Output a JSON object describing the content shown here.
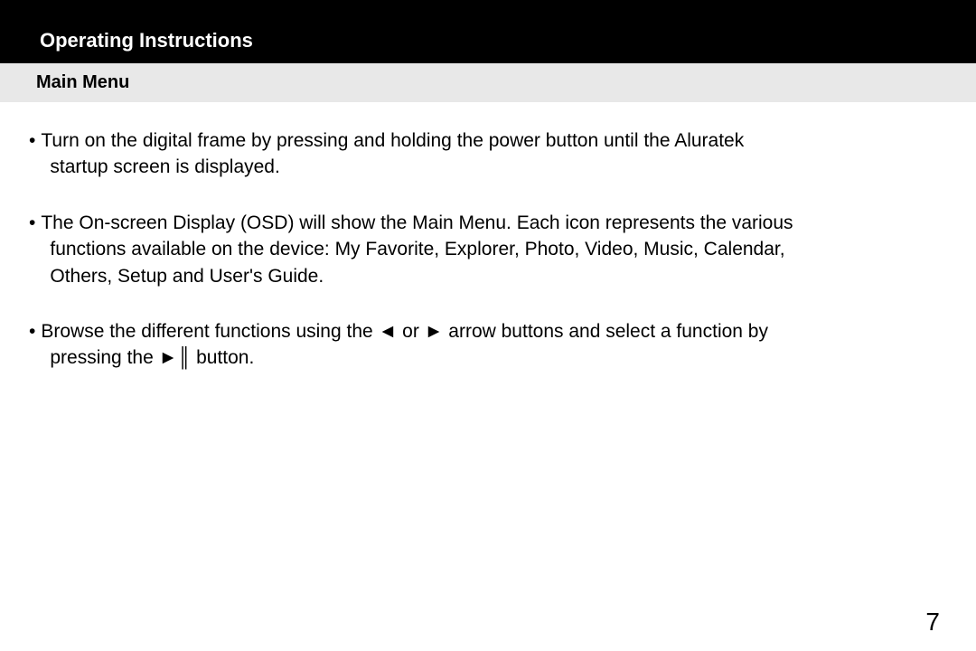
{
  "header": {
    "title": "Operating Instructions",
    "subtitle": "Main Menu"
  },
  "bullets": [
    {
      "line1": "Turn on the digital frame by pressing and holding the power button until the Aluratek",
      "line2": "startup screen is displayed."
    },
    {
      "line1": "The On-screen Display (OSD) will show the Main Menu. Each icon represents the various",
      "line2": "functions available on the device: My Favorite, Explorer, Photo, Video, Music, Calendar,",
      "line3": "Others, Setup and User's Guide."
    },
    {
      "line1": "Browse the different functions using the ◄ or ► arrow buttons and select a function by",
      "line2": "pressing the ►║ button."
    }
  ],
  "page_number": "7"
}
